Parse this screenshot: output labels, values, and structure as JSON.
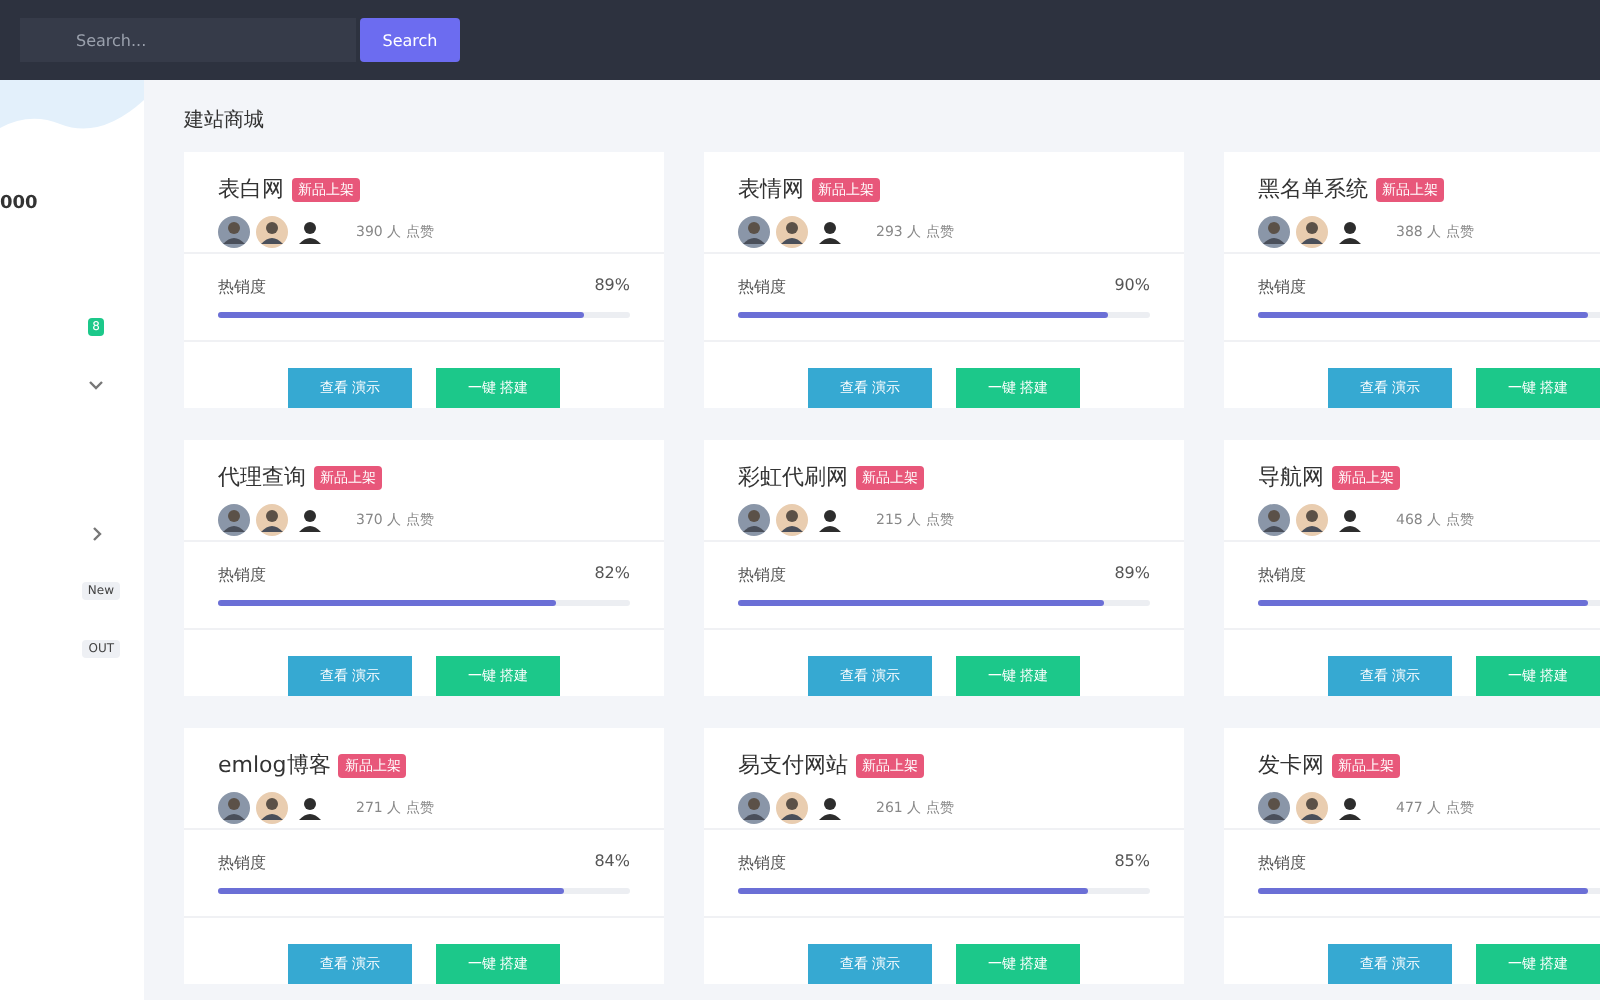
{
  "topbar": {
    "search": {
      "placeholder": "Search..."
    },
    "search_button": "Search"
  },
  "sidebar": {
    "balance": "000",
    "items": [
      {
        "kind": "count",
        "text": "8"
      },
      {
        "kind": "chevron-down"
      },
      {
        "kind": "gap"
      },
      {
        "kind": "chevron-right"
      },
      {
        "kind": "tag",
        "text": "New"
      },
      {
        "kind": "tag",
        "text": "OUT"
      }
    ]
  },
  "main": {
    "heading": "建站商城",
    "cards": [
      {
        "title": "表白网",
        "badge": "新品上架",
        "likes": "390 人 点赞",
        "metric": "热销度",
        "percent": "89%",
        "level": 0.89,
        "buttons": [
          "查看 演示",
          "一键 搭建"
        ]
      },
      {
        "title": "表情网",
        "badge": "新品上架",
        "likes": "293 人 点赞",
        "metric": "热销度",
        "percent": "90%",
        "level": 0.9,
        "buttons": [
          "查看 演示",
          "一键 搭建"
        ]
      },
      {
        "title": "黑名单系统",
        "badge": "新品上架",
        "likes": "388 人 点赞",
        "metric": "热销度",
        "level": 0.8,
        "buttons": [
          "查看 演示",
          "一键 搭建"
        ]
      },
      {
        "title": "代理查询",
        "badge": "新品上架",
        "likes": "370 人 点赞",
        "metric": "热销度",
        "percent": "82%",
        "level": 0.82,
        "buttons": [
          "查看 演示",
          "一键 搭建"
        ]
      },
      {
        "title": "彩虹代刷网",
        "badge": "新品上架",
        "likes": "215 人 点赞",
        "metric": "热销度",
        "percent": "89%",
        "level": 0.89,
        "buttons": [
          "查看 演示",
          "一键 搭建"
        ]
      },
      {
        "title": "导航网",
        "badge": "新品上架",
        "likes": "468 人 点赞",
        "metric": "热销度",
        "level": 0.8,
        "buttons": [
          "查看 演示",
          "一键 搭建"
        ]
      },
      {
        "title": "emlog博客",
        "badge": "新品上架",
        "likes": "271 人 点赞",
        "metric": "热销度",
        "percent": "84%",
        "level": 0.84,
        "buttons": [
          "查看 演示",
          "一键 搭建"
        ]
      },
      {
        "title": "易支付网站",
        "badge": "新品上架",
        "likes": "261 人 点赞",
        "metric": "热销度",
        "percent": "85%",
        "level": 0.85,
        "buttons": [
          "查看 演示",
          "一键 搭建"
        ]
      },
      {
        "title": "发卡网",
        "badge": "新品上架",
        "likes": "477 人 点赞",
        "metric": "热销度",
        "level": 0.8,
        "buttons": [
          "查看 演示",
          "一键 搭建"
        ]
      }
    ]
  }
}
